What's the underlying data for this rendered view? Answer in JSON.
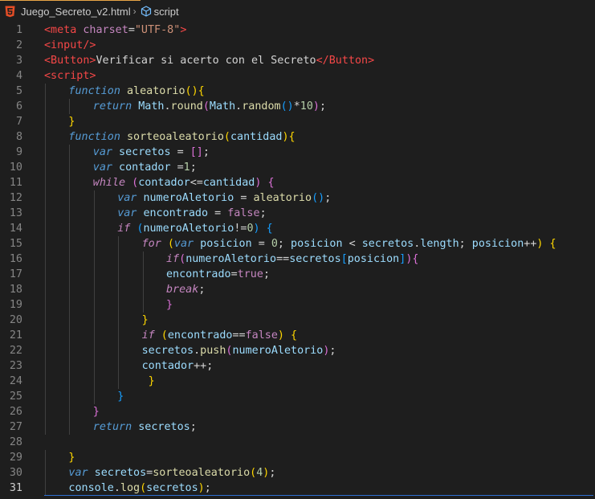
{
  "breadcrumb": {
    "file_icon": "html5-icon",
    "file_name": "Juego_Secreto_v2.html",
    "separator": "›",
    "symbol_icon": "cube-icon",
    "symbol_name": "script"
  },
  "colors": {
    "background": "#1e1e1e",
    "keyword": "#569cd6",
    "control": "#c586c0",
    "function": "#dcdcaa",
    "variable": "#9cdcfe",
    "number": "#b5cea8",
    "string": "#ce9178",
    "tag": "#f44747",
    "bracket_level1": "#ffd700",
    "bracket_level2": "#da70d6",
    "bracket_level3": "#179fff"
  },
  "editor": {
    "active_line": 31,
    "lines": [
      {
        "n": "1",
        "indent": 0,
        "tokens": [
          [
            "tag",
            "<meta "
          ],
          [
            "attr",
            "charset"
          ],
          [
            "plain",
            "="
          ],
          [
            "str",
            "\"UTF-8\""
          ],
          [
            "tag",
            ">"
          ]
        ]
      },
      {
        "n": "2",
        "indent": 0,
        "tokens": [
          [
            "tag",
            "<input/>"
          ]
        ]
      },
      {
        "n": "3",
        "indent": 0,
        "tokens": [
          [
            "tag",
            "<Button>"
          ],
          [
            "plain",
            "Verificar si acerto con el Secreto"
          ],
          [
            "tag",
            "</Button>"
          ]
        ]
      },
      {
        "n": "4",
        "indent": 0,
        "tokens": [
          [
            "tag",
            "<script>"
          ]
        ]
      },
      {
        "n": "5",
        "indent": 1,
        "tokens": [
          [
            "kw-i",
            "function "
          ],
          [
            "fn",
            "aleatorio"
          ],
          [
            "b1",
            "(){"
          ]
        ]
      },
      {
        "n": "6",
        "indent": 2,
        "tokens": [
          [
            "kw-i",
            "return "
          ],
          [
            "var",
            "Math"
          ],
          [
            "plain",
            "."
          ],
          [
            "fn",
            "round"
          ],
          [
            "b2",
            "("
          ],
          [
            "var",
            "Math"
          ],
          [
            "plain",
            "."
          ],
          [
            "fn",
            "random"
          ],
          [
            "b3",
            "()"
          ],
          [
            "plain",
            "*"
          ],
          [
            "num",
            "10"
          ],
          [
            "b2",
            ")"
          ],
          [
            "plain",
            ";"
          ]
        ]
      },
      {
        "n": "7",
        "indent": 1,
        "tokens": [
          [
            "b1",
            "}"
          ]
        ]
      },
      {
        "n": "8",
        "indent": 1,
        "tokens": [
          [
            "kw-i",
            "function "
          ],
          [
            "fn",
            "sorteoaleatorio"
          ],
          [
            "b1",
            "("
          ],
          [
            "var",
            "cantidad"
          ],
          [
            "b1",
            ")"
          ],
          [
            "b1",
            "{"
          ]
        ]
      },
      {
        "n": "9",
        "indent": 2,
        "tokens": [
          [
            "kw-i",
            "var "
          ],
          [
            "var",
            "secretos"
          ],
          [
            "plain",
            " = "
          ],
          [
            "b2",
            "[]"
          ],
          [
            "plain",
            ";"
          ]
        ]
      },
      {
        "n": "10",
        "indent": 2,
        "tokens": [
          [
            "kw-i",
            "var "
          ],
          [
            "var",
            "contador"
          ],
          [
            "plain",
            " ="
          ],
          [
            "num",
            "1"
          ],
          [
            "plain",
            ";"
          ]
        ]
      },
      {
        "n": "11",
        "indent": 2,
        "tokens": [
          [
            "ctrl",
            "while "
          ],
          [
            "b2",
            "("
          ],
          [
            "var",
            "contador"
          ],
          [
            "plain",
            "<="
          ],
          [
            "var",
            "cantidad"
          ],
          [
            "b2",
            ")"
          ],
          [
            "plain",
            " "
          ],
          [
            "b2",
            "{"
          ]
        ]
      },
      {
        "n": "12",
        "indent": 3,
        "tokens": [
          [
            "kw-i",
            "var "
          ],
          [
            "var",
            "numeroAletorio"
          ],
          [
            "plain",
            " = "
          ],
          [
            "fn",
            "aleatorio"
          ],
          [
            "b3",
            "()"
          ],
          [
            "plain",
            ";"
          ]
        ]
      },
      {
        "n": "13",
        "indent": 3,
        "tokens": [
          [
            "kw-i",
            "var "
          ],
          [
            "var",
            "encontrado"
          ],
          [
            "plain",
            " = "
          ],
          [
            "bool",
            "false"
          ],
          [
            "plain",
            ";"
          ]
        ]
      },
      {
        "n": "14",
        "indent": 3,
        "tokens": [
          [
            "ctrl",
            "if "
          ],
          [
            "b3",
            "("
          ],
          [
            "var",
            "numeroAletorio"
          ],
          [
            "plain",
            "!="
          ],
          [
            "num",
            "0"
          ],
          [
            "b3",
            ")"
          ],
          [
            "plain",
            " "
          ],
          [
            "b3",
            "{"
          ]
        ]
      },
      {
        "n": "15",
        "indent": 4,
        "tokens": [
          [
            "ctrl",
            "for "
          ],
          [
            "b1",
            "("
          ],
          [
            "kw-i",
            "var "
          ],
          [
            "var",
            "posicion"
          ],
          [
            "plain",
            " = "
          ],
          [
            "num",
            "0"
          ],
          [
            "plain",
            "; "
          ],
          [
            "var",
            "posicion"
          ],
          [
            "plain",
            " < "
          ],
          [
            "var",
            "secretos"
          ],
          [
            "plain",
            "."
          ],
          [
            "var",
            "length"
          ],
          [
            "plain",
            "; "
          ],
          [
            "var",
            "posicion"
          ],
          [
            "plain",
            "++"
          ],
          [
            "b1",
            ")"
          ],
          [
            "plain",
            " "
          ],
          [
            "b1",
            "{"
          ]
        ]
      },
      {
        "n": "16",
        "indent": 5,
        "tokens": [
          [
            "ctrl",
            "if"
          ],
          [
            "b2",
            "("
          ],
          [
            "var",
            "numeroAletorio"
          ],
          [
            "plain",
            "=="
          ],
          [
            "var",
            "secretos"
          ],
          [
            "b3",
            "["
          ],
          [
            "var",
            "posicion"
          ],
          [
            "b3",
            "]"
          ],
          [
            "b2",
            ")"
          ],
          [
            "b2",
            "{"
          ]
        ]
      },
      {
        "n": "17",
        "indent": 5,
        "tokens": [
          [
            "var",
            "encontrado"
          ],
          [
            "plain",
            "="
          ],
          [
            "bool",
            "true"
          ],
          [
            "plain",
            ";"
          ]
        ]
      },
      {
        "n": "18",
        "indent": 5,
        "tokens": [
          [
            "ctrl",
            "break"
          ],
          [
            "plain",
            ";"
          ]
        ]
      },
      {
        "n": "19",
        "indent": 5,
        "tokens": [
          [
            "b2",
            "}"
          ]
        ]
      },
      {
        "n": "20",
        "indent": 4,
        "tokens": [
          [
            "b1",
            "}"
          ]
        ]
      },
      {
        "n": "21",
        "indent": 4,
        "tokens": [
          [
            "ctrl",
            "if "
          ],
          [
            "b1",
            "("
          ],
          [
            "var",
            "encontrado"
          ],
          [
            "plain",
            "=="
          ],
          [
            "bool",
            "false"
          ],
          [
            "b1",
            ")"
          ],
          [
            "plain",
            " "
          ],
          [
            "b1",
            "{"
          ]
        ]
      },
      {
        "n": "22",
        "indent": 4,
        "tokens": [
          [
            "var",
            "secretos"
          ],
          [
            "plain",
            "."
          ],
          [
            "fn",
            "push"
          ],
          [
            "b2",
            "("
          ],
          [
            "var",
            "numeroAletorio"
          ],
          [
            "b2",
            ")"
          ],
          [
            "plain",
            ";"
          ]
        ]
      },
      {
        "n": "23",
        "indent": 4,
        "tokens": [
          [
            "var",
            "contador"
          ],
          [
            "plain",
            "++;"
          ]
        ]
      },
      {
        "n": "24",
        "indent": 4,
        "tokens": [
          [
            "plain",
            " "
          ],
          [
            "b1",
            "}"
          ]
        ]
      },
      {
        "n": "25",
        "indent": 3,
        "tokens": [
          [
            "b3",
            "}"
          ]
        ]
      },
      {
        "n": "26",
        "indent": 2,
        "tokens": [
          [
            "b2",
            "}"
          ]
        ]
      },
      {
        "n": "27",
        "indent": 2,
        "tokens": [
          [
            "kw-i",
            "return "
          ],
          [
            "var",
            "secretos"
          ],
          [
            "plain",
            ";"
          ]
        ]
      },
      {
        "n": "28",
        "indent": 0,
        "tokens": []
      },
      {
        "n": "29",
        "indent": 1,
        "tokens": [
          [
            "b1",
            "}"
          ]
        ]
      },
      {
        "n": "30",
        "indent": 1,
        "tokens": [
          [
            "kw-i",
            "var "
          ],
          [
            "var",
            "secretos"
          ],
          [
            "plain",
            "="
          ],
          [
            "fn",
            "sorteoaleatorio"
          ],
          [
            "b1",
            "("
          ],
          [
            "num",
            "4"
          ],
          [
            "b1",
            ")"
          ],
          [
            "plain",
            ";"
          ]
        ]
      },
      {
        "n": "31",
        "indent": 1,
        "tokens": [
          [
            "var",
            "console"
          ],
          [
            "plain",
            "."
          ],
          [
            "fn",
            "log"
          ],
          [
            "b1",
            "("
          ],
          [
            "var",
            "secretos"
          ],
          [
            "b1",
            ")"
          ],
          [
            "plain",
            ";"
          ]
        ]
      }
    ]
  }
}
